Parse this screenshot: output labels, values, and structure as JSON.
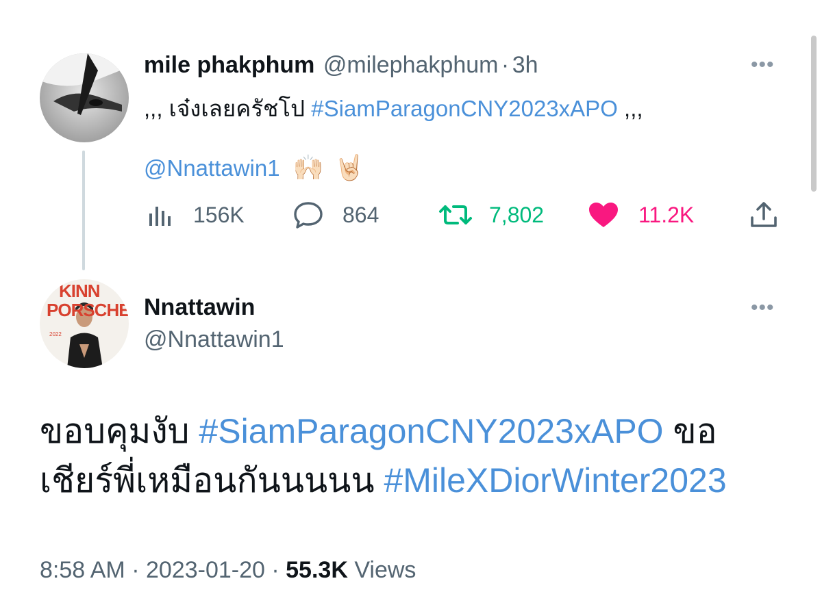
{
  "tweet1": {
    "name": "mile phakphum",
    "handle": "@milephakphum",
    "separator": "·",
    "time": "3h",
    "text_prefix": ",,, เจ๋งเลยครัชโป",
    "hashtag": "#SiamParagonCNY2023xAPO",
    "text_suffix": ",,,",
    "mention": "@Nnattawin1",
    "emoji1": "🙌🏻",
    "emoji2": "🤘🏻",
    "views": "156K",
    "replies": "864",
    "retweets": "7,802",
    "likes": "11.2K",
    "more": "•••"
  },
  "tweet2": {
    "name": "Nnattawin",
    "handle": "@Nnattawin1",
    "more": "•••",
    "avatar_text_top": "KINN",
    "avatar_text_bottom": "PORSCHE",
    "avatar_small_text": "2022",
    "text_part1": "ขอบคุมงับ",
    "hashtag1": "#SiamParagonCNY2023xAPO",
    "text_part2": "ขอ",
    "text_part3": "เชียร์พี่เหมือนกันนนนน",
    "hashtag2": "#MileXDiorWinter2023",
    "time": "8:58 AM",
    "sep": "·",
    "date": "2023-01-20",
    "views_count": "55.3K",
    "views_label": "Views"
  },
  "colors": {
    "link": "#4a90d9",
    "retweet": "#00ba7c",
    "like": "#f91880",
    "muted": "#536471"
  },
  "icons": [
    "views-icon",
    "reply-icon",
    "retweet-icon",
    "like-icon",
    "share-icon"
  ]
}
